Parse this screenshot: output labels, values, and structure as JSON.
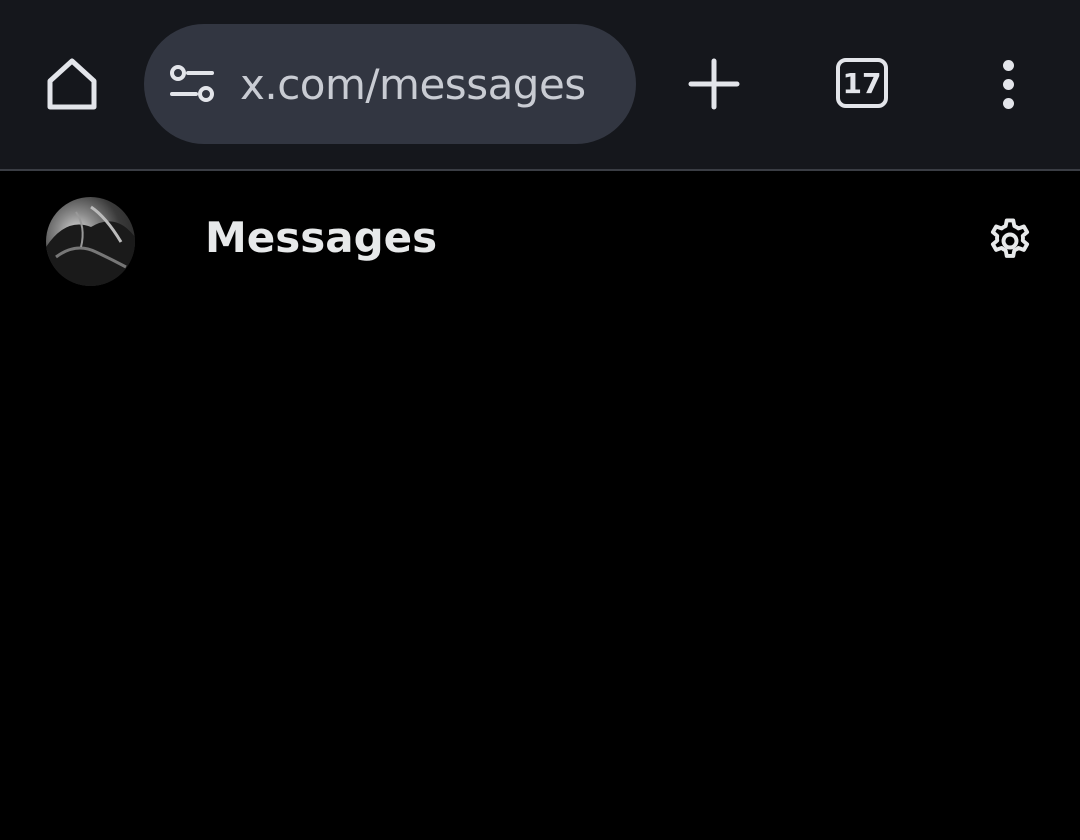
{
  "browser": {
    "url": "x.com/messages",
    "tab_count": "17",
    "icons": {
      "home": "home-icon",
      "site_info": "tune-icon",
      "new_tab": "plus-icon",
      "tabs": "tab-switcher-icon",
      "menu": "more-vert-icon"
    }
  },
  "header": {
    "title": "Messages",
    "icons": {
      "avatar": "user-avatar",
      "settings": "gear-icon"
    }
  },
  "colors": {
    "toolbar_bg": "#15171c",
    "omnibox_bg": "#323641",
    "page_bg": "#000000",
    "text": "#e7e9ea"
  }
}
